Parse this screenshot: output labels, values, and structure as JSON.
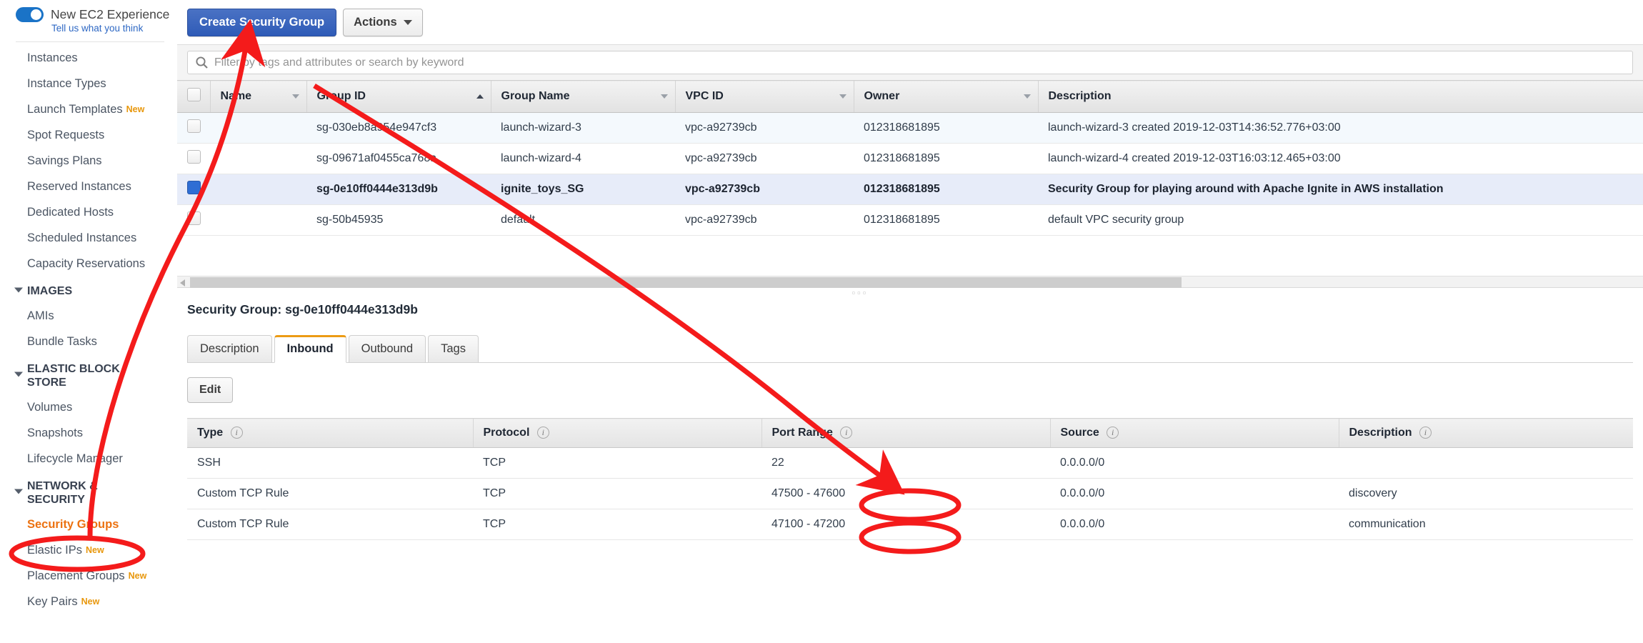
{
  "sidebar": {
    "new_experience": {
      "label": "New EC2 Experience",
      "sublabel": "Tell us what you think",
      "toggle_on": true
    },
    "items": [
      {
        "type": "item",
        "label": "Instances"
      },
      {
        "type": "item",
        "label": "Instance Types"
      },
      {
        "type": "item",
        "label": "Launch Templates",
        "badge": "New"
      },
      {
        "type": "item",
        "label": "Spot Requests"
      },
      {
        "type": "item",
        "label": "Savings Plans"
      },
      {
        "type": "item",
        "label": "Reserved Instances"
      },
      {
        "type": "item",
        "label": "Dedicated Hosts"
      },
      {
        "type": "item",
        "label": "Scheduled Instances"
      },
      {
        "type": "item",
        "label": "Capacity Reservations"
      },
      {
        "type": "group",
        "label": "IMAGES"
      },
      {
        "type": "item",
        "label": "AMIs"
      },
      {
        "type": "item",
        "label": "Bundle Tasks"
      },
      {
        "type": "group",
        "label": "ELASTIC BLOCK\nSTORE"
      },
      {
        "type": "item",
        "label": "Volumes"
      },
      {
        "type": "item",
        "label": "Snapshots"
      },
      {
        "type": "item",
        "label": "Lifecycle Manager"
      },
      {
        "type": "group",
        "label": "NETWORK &\nSECURITY"
      },
      {
        "type": "item",
        "label": "Security Groups",
        "active": true
      },
      {
        "type": "item",
        "label": "Elastic IPs",
        "badge": "New"
      },
      {
        "type": "item",
        "label": "Placement Groups",
        "badge": "New"
      },
      {
        "type": "item",
        "label": "Key Pairs",
        "badge": "New"
      }
    ]
  },
  "toolbar": {
    "create_label": "Create Security Group",
    "actions_label": "Actions"
  },
  "search": {
    "placeholder": "Filter by tags and attributes or search by keyword",
    "value": ""
  },
  "groups_table": {
    "columns": [
      {
        "label": "Name",
        "sort": "desc"
      },
      {
        "label": "Group ID",
        "sort": "asc"
      },
      {
        "label": "Group Name",
        "sort": "desc"
      },
      {
        "label": "VPC ID",
        "sort": "desc"
      },
      {
        "label": "Owner",
        "sort": "desc"
      },
      {
        "label": "Description",
        "sort": "none"
      }
    ],
    "rows": [
      {
        "checked": false,
        "name": "",
        "group_id": "sg-030eb8a954e947cf3",
        "group_name": "launch-wizard-3",
        "vpc_id": "vpc-a92739cb",
        "owner": "012318681895",
        "description": "launch-wizard-3 created 2019-12-03T14:36:52.776+03:00"
      },
      {
        "checked": false,
        "name": "",
        "group_id": "sg-09671af0455ca768a",
        "group_name": "launch-wizard-4",
        "vpc_id": "vpc-a92739cb",
        "owner": "012318681895",
        "description": "launch-wizard-4 created 2019-12-03T16:03:12.465+03:00"
      },
      {
        "checked": true,
        "selected": true,
        "name": "",
        "group_id": "sg-0e10ff0444e313d9b",
        "group_name": "ignite_toys_SG",
        "vpc_id": "vpc-a92739cb",
        "owner": "012318681895",
        "description": "Security Group for playing around with Apache Ignite in AWS installation"
      },
      {
        "checked": false,
        "name": "",
        "group_id": "sg-50b45935",
        "group_name": "default",
        "vpc_id": "vpc-a92739cb",
        "owner": "012318681895",
        "description": "default VPC security group"
      }
    ]
  },
  "detail": {
    "title": "Security Group: sg-0e10ff0444e313d9b",
    "tabs": [
      {
        "label": "Description",
        "active": false
      },
      {
        "label": "Inbound",
        "active": true
      },
      {
        "label": "Outbound",
        "active": false
      },
      {
        "label": "Tags",
        "active": false
      }
    ],
    "edit_label": "Edit",
    "rules_columns": [
      "Type",
      "Protocol",
      "Port Range",
      "Source",
      "Description"
    ],
    "rules": [
      {
        "type": "SSH",
        "protocol": "TCP",
        "port_range": "22",
        "source": "0.0.0.0/0",
        "description": ""
      },
      {
        "type": "Custom TCP Rule",
        "protocol": "TCP",
        "port_range": "47500 - 47600",
        "source": "0.0.0.0/0",
        "description": "discovery"
      },
      {
        "type": "Custom TCP Rule",
        "protocol": "TCP",
        "port_range": "47100 - 47200",
        "source": "0.0.0.0/0",
        "description": "communication"
      }
    ]
  },
  "annotations": {
    "color": "#f41b1b",
    "marks": [
      {
        "kind": "ellipse",
        "target": "sidebar-item-security-groups"
      },
      {
        "kind": "ellipse",
        "target": "port-range-47500-47600"
      },
      {
        "kind": "ellipse",
        "target": "port-range-47100-47200"
      },
      {
        "kind": "arrow",
        "target": "create-security-group-button"
      },
      {
        "kind": "arrow",
        "target": "port-range-column"
      }
    ]
  },
  "colors": {
    "primary_button": "#2f5bb7",
    "accent_orange": "#ec7211",
    "tab_active_underline": "#ec9b14",
    "selected_row": "#e7ecf9",
    "alt_row": "#f4f9fd",
    "annotation_red": "#f41b1b"
  }
}
